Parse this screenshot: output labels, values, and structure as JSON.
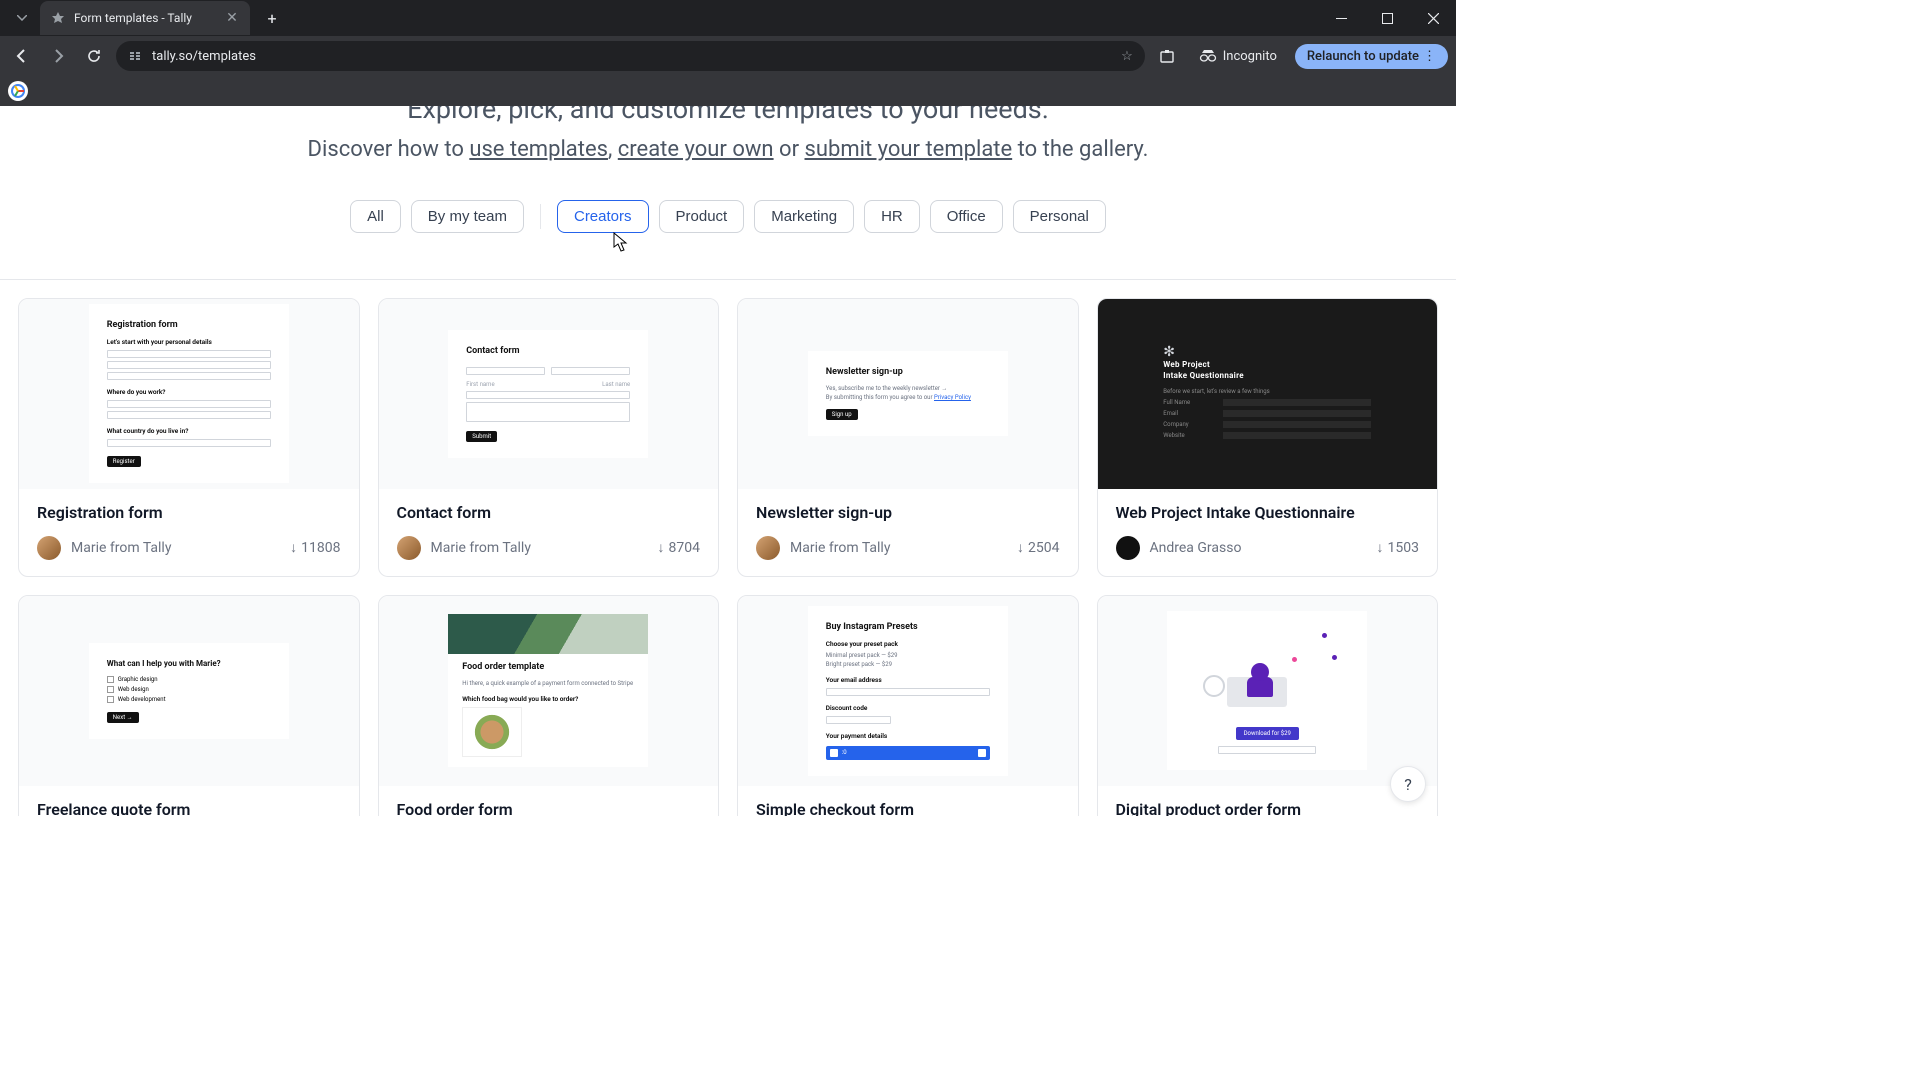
{
  "browser": {
    "tab_title": "Form templates - Tally",
    "url": "tally.so/templates",
    "incognito_label": "Incognito",
    "update_label": "Relaunch to update"
  },
  "heading": {
    "tagline": "Explore, pick, and customize templates to your needs.",
    "line2_prefix": "Discover how to ",
    "link1": "use templates",
    "sep1": ", ",
    "link2": "create your own",
    "sep2": " or ",
    "link3": "submit your template",
    "line2_suffix": " to the gallery."
  },
  "filters": {
    "all": "All",
    "by_my_team": "By my team",
    "creators": "Creators",
    "product": "Product",
    "marketing": "Marketing",
    "hr": "HR",
    "office": "Office",
    "personal": "Personal"
  },
  "cards": [
    {
      "title": "Registration form",
      "author": "Marie from Tally",
      "downloads": "11808"
    },
    {
      "title": "Contact form",
      "author": "Marie from Tally",
      "downloads": "8704"
    },
    {
      "title": "Newsletter sign-up",
      "author": "Marie from Tally",
      "downloads": "2504"
    },
    {
      "title": "Web Project Intake Questionnaire",
      "author": "Andrea Grasso",
      "downloads": "1503"
    },
    {
      "title": "Freelance quote form",
      "author": "",
      "downloads": ""
    },
    {
      "title": "Food order form",
      "author": "",
      "downloads": ""
    },
    {
      "title": "Simple checkout form",
      "author": "",
      "downloads": ""
    },
    {
      "title": "Digital product order form",
      "author": "",
      "downloads": ""
    }
  ],
  "thumbs": {
    "reg": {
      "title": "Registration form",
      "sub1": "Let's start with your personal details",
      "sub2": "Where do you work?",
      "sub3": "What country do you live in?",
      "btn": "Register"
    },
    "contact": {
      "title": "Contact form",
      "btn": "Submit"
    },
    "newsletter": {
      "title": "Newsletter sign-up",
      "btn": "Sign up"
    },
    "web": {
      "logo": "✻",
      "title1": "Web Project",
      "title2": "Intake Questionnaire"
    },
    "freelance": {
      "title": "What can I help you with Marie?",
      "opt1": "Graphic design",
      "opt2": "Web design",
      "opt3": "Web development",
      "btn": "Next →"
    },
    "food": {
      "title": "Food order template",
      "sub": "Which food bag would you like to order?"
    },
    "checkout": {
      "title": "Buy Instagram Presets",
      "sub1": "Choose your preset pack",
      "sub2": "Your email address",
      "sub3": "Discount code",
      "sub4": "Your payment details",
      "num": ":0"
    },
    "digital": {
      "btn": "Download for $29"
    }
  },
  "help": "?"
}
